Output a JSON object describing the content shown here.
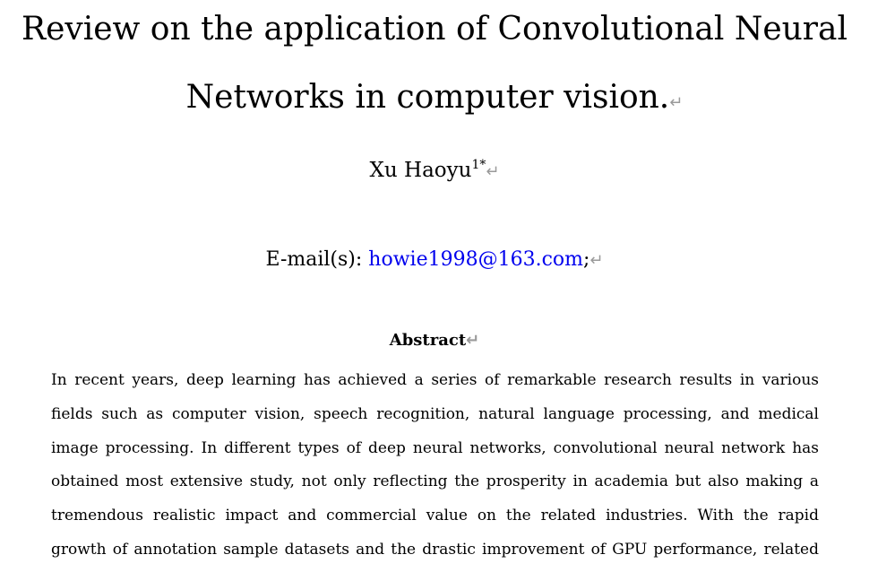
{
  "paper": {
    "title_line1": "Review on the application of Convolutional Neural",
    "title_line2": "Networks in computer vision.",
    "author_name": "Xu Haoyu",
    "author_affiliation_mark": "1*",
    "email_label": "E-mail(s): ",
    "email_address": "howie1998@163.com",
    "email_trailing": ";",
    "paragraph_mark": "↵",
    "abstract_heading": "Abstract",
    "abstract_lines": [
      "In recent years, deep learning has achieved a series of remarkable research results in various",
      "fields such as computer vision, speech recognition, natural language processing, and medical",
      "image processing. In different types of deep neural networks, convolutional neural network has",
      "obtained most extensive study, not only reflecting the prosperity in academia but also making a",
      "tremendous realistic impact and commercial value on the related industries. With the rapid",
      "growth of annotation sample datasets and the drastic improvement of GPU performance, related"
    ]
  },
  "colors": {
    "link": "#0000ee",
    "paragraph_mark": "#9a9a9a"
  }
}
